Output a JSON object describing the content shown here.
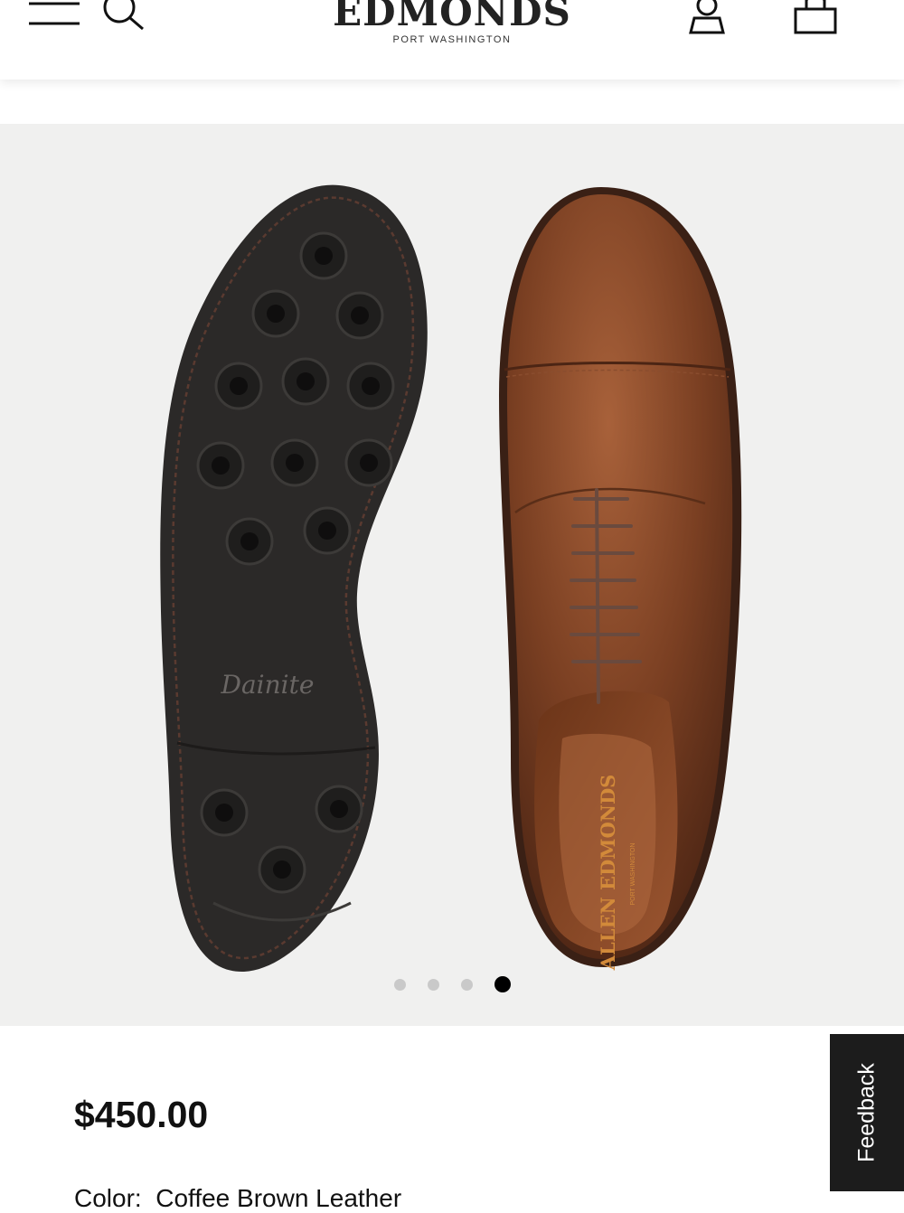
{
  "header": {
    "brand_name": "EDMONDS",
    "brand_location": "PORT WASHINGTON",
    "icons": [
      "menu-icon",
      "search-icon",
      "account-icon",
      "shopping-bag-icon"
    ]
  },
  "gallery": {
    "sole_brand": "Dainite",
    "insole_brand": "ALLEN EDMONDS",
    "insole_sub": "PORT WASHINGTON",
    "slide_count": 4,
    "active_slide": 4
  },
  "product": {
    "price": "$450.00",
    "color_label": "Color:",
    "color_value": "Coffee Brown Leather"
  },
  "feedback_label": "Feedback",
  "colors": {
    "leather": "#7a3f22",
    "sole": "#2b2928",
    "background": "#f0f0ef",
    "active_dot": "#000000"
  }
}
